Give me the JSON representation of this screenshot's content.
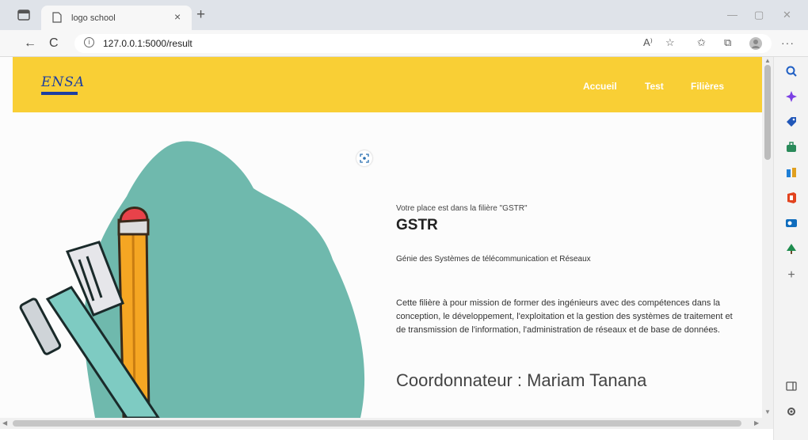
{
  "browser": {
    "tab_title": "logo school",
    "tab_close": "×",
    "new_tab": "+",
    "window_controls": {
      "minimize": "—",
      "maximize": "▢",
      "close": "✕"
    },
    "nav": {
      "back": "←",
      "refresh": "C"
    },
    "url": "127.0.0.1:5000/result",
    "url_icons": {
      "read_aloud": "A⁾",
      "favorite": "☆",
      "favorites_bar": "✩",
      "collections": "⧉"
    },
    "more": "···",
    "sidebar_icons": [
      "search-icon",
      "copilot-icon",
      "shopping-tag-icon",
      "tools-icon",
      "games-icon",
      "office-icon",
      "outlook-icon",
      "tree-icon",
      "add-icon"
    ],
    "sidebar_add": "+"
  },
  "site": {
    "logo_text": "ENSA",
    "nav": [
      {
        "label": "Accueil"
      },
      {
        "label": "Test"
      },
      {
        "label": "Filières"
      }
    ]
  },
  "result": {
    "placement": "Votre place est dans la filière \"GSTR\"",
    "code": "GSTR",
    "full_name": "Génie des Systèmes de télécommunication et Réseaux",
    "description": "Cette filière à pour mission de former des ingénieurs avec des compétences dans la conception, le développement, l'exploitation et la gestion des systèmes de traitement et de transmission de l'information, l'administration de réseaux et de base de données.",
    "coordinator": "Coordonnateur : Mariam Tanana"
  },
  "colors": {
    "header_bg": "#f9cf35",
    "blob": "#6fb9ad",
    "logo": "#1c3fa1"
  }
}
